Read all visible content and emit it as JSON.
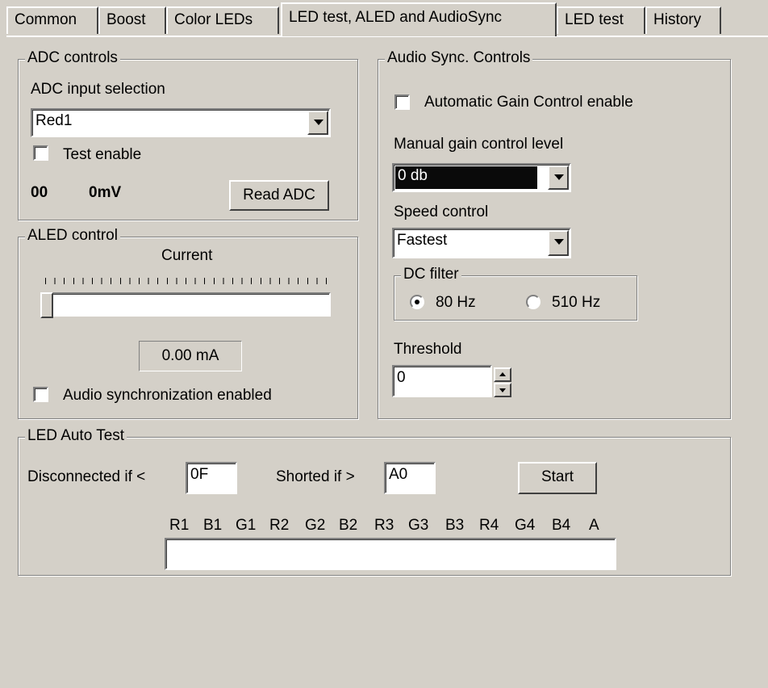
{
  "tabs": [
    {
      "label": "Common"
    },
    {
      "label": "Boost"
    },
    {
      "label": "Color LEDs"
    },
    {
      "label": "LED test, ALED and AudioSync",
      "active": true
    },
    {
      "label": "LED test"
    },
    {
      "label": "History"
    }
  ],
  "adc": {
    "title": "ADC controls",
    "input_label": "ADC input selection",
    "input_value": "Red1",
    "test_enable_label": "Test enable",
    "code": "00",
    "voltage": "0mV",
    "read_button": "Read ADC"
  },
  "aled": {
    "title": "ALED control",
    "current_label": "Current",
    "current_value": "0.00 mA",
    "current_level": 0,
    "audio_sync_label": "Audio synchronization enabled"
  },
  "audio": {
    "title": "Audio Sync. Controls",
    "agc_label": "Automatic Gain Control enable",
    "gain_label": "Manual gain control level",
    "gain_value": "0 db",
    "speed_label": "Speed control",
    "speed_value": "Fastest",
    "dc_filter_title": "DC filter",
    "dc_80_label": "80 Hz",
    "dc_510_label": "510 Hz",
    "dc_selected": "80 Hz",
    "threshold_label": "Threshold",
    "threshold_value": "0"
  },
  "auto_test": {
    "title": "LED Auto Test",
    "disconnected_label": "Disconnected if <",
    "disconnected_value": "0F",
    "shorted_label": "Shorted if >",
    "shorted_value": "A0",
    "start_button": "Start",
    "channels": [
      "R1",
      "B1",
      "G1",
      "R2",
      "G2",
      "B2",
      "R3",
      "G3",
      "B3",
      "R4",
      "G4",
      "B4",
      "A"
    ]
  },
  "colors": {
    "face": "#d4d0c8",
    "highlight": "#fff",
    "shadow": "#808080",
    "selection": "#0a0a0a"
  }
}
